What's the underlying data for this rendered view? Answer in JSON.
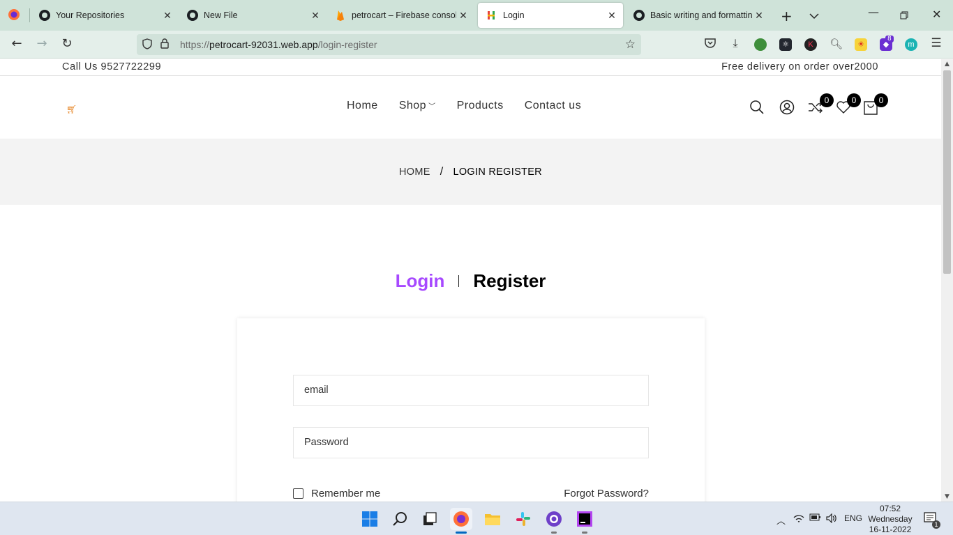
{
  "browser": {
    "tabs": [
      {
        "title": "Your Repositories",
        "icon": "github-icon",
        "active": false
      },
      {
        "title": "New File",
        "icon": "github-icon",
        "active": false
      },
      {
        "title": "petrocart – Firebase console",
        "icon": "firebase-icon",
        "active": false
      },
      {
        "title": "Login",
        "icon": "site-favicon",
        "active": true
      },
      {
        "title": "Basic writing and formatting",
        "icon": "github-icon",
        "active": false
      }
    ],
    "url_prefix": "https://",
    "url_host": "petrocart-92031.web.app",
    "url_path": "/login-register",
    "extension_badge": "8",
    "extension_m": "m",
    "extension_k": "K"
  },
  "site": {
    "topbar": {
      "call": "Call Us 9527722299",
      "delivery": "Free delivery on order over2000"
    },
    "menu": {
      "home": "Home",
      "shop": "Shop",
      "products": "Products",
      "contact": "Contact us"
    },
    "badges": {
      "compare": "0",
      "wishlist": "0",
      "cart": "0"
    },
    "breadcrumb": {
      "home": "HOME",
      "separator": "/",
      "current": "LOGIN REGISTER"
    },
    "auth": {
      "login_tab": "Login",
      "register_tab": "Register",
      "email_placeholder": "email",
      "password_placeholder": "Password",
      "remember": "Remember me",
      "forgot": "Forgot Password?"
    },
    "colors": {
      "accent": "#a749ff",
      "badge": "#000000"
    }
  },
  "taskbar": {
    "language": "ENG",
    "time": "07:52",
    "day": "Wednesday",
    "date": "16-11-2022",
    "notification_count": "1"
  }
}
